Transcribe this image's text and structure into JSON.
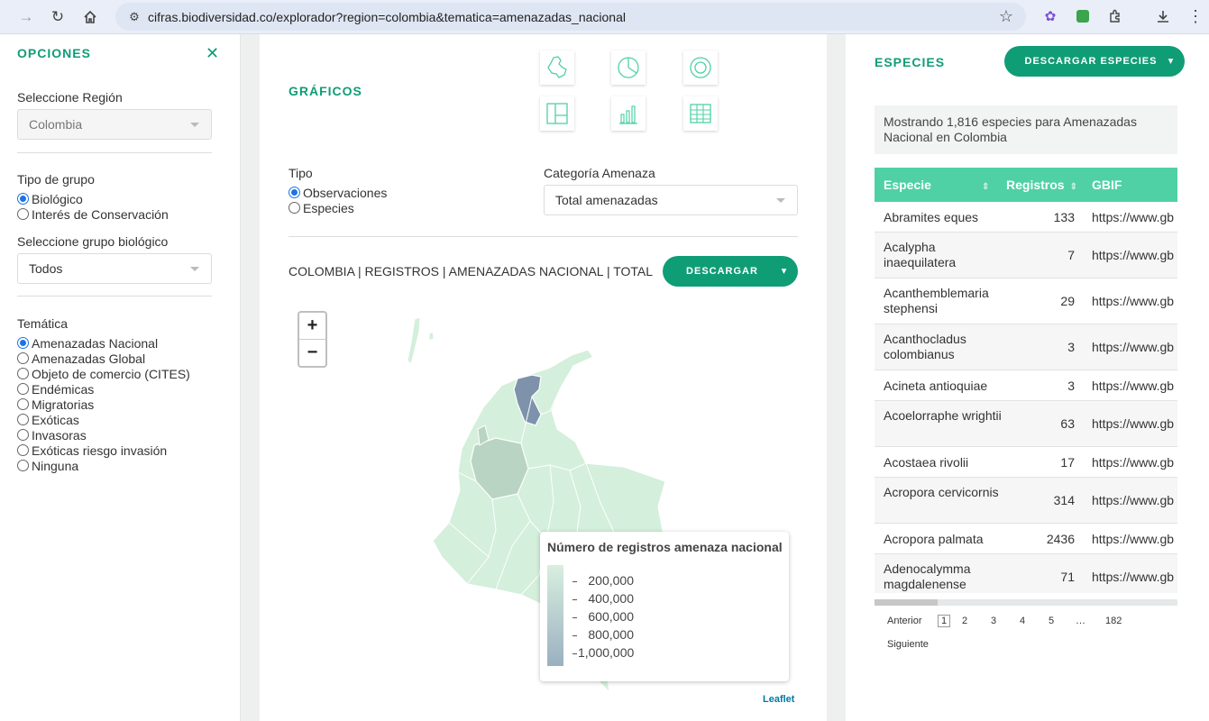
{
  "browser": {
    "url": "cifras.biodiversidad.co/explorador?region=colombia&tematica=amenazadas_nacional"
  },
  "left": {
    "title": "OPCIONES",
    "region_label": "Seleccione Región",
    "region_value": "Colombia",
    "group_type_label": "Tipo de grupo",
    "group_types": [
      "Biológico",
      "Interés de Conservación"
    ],
    "group_type_selected": "Biológico",
    "bio_group_label": "Seleccione grupo biológico",
    "bio_group_value": "Todos",
    "theme_label": "Temática",
    "themes": [
      "Amenazadas Nacional",
      "Amenazadas Global",
      "Objeto de comercio (CITES)",
      "Endémicas",
      "Migratorias",
      "Exóticas",
      "Invasoras",
      "Exóticas riesgo invasión",
      "Ninguna"
    ],
    "theme_selected": "Amenazadas Nacional"
  },
  "center": {
    "charts_title": "GRÁFICOS",
    "chart_icons": [
      "map-icon",
      "pie-chart-icon",
      "donut-chart-icon",
      "treemap-icon",
      "bar-chart-icon",
      "table-icon"
    ],
    "tipo_label": "Tipo",
    "tipo_options": [
      "Observaciones",
      "Especies"
    ],
    "tipo_selected": "Observaciones",
    "category_label": "Categoría Amenaza",
    "category_value": "Total amenazadas",
    "map_title": "COLOMBIA | REGISTROS | AMENAZADAS NACIONAL | TOTAL",
    "download_label": "DESCARGAR",
    "zoom_in": "+",
    "zoom_out": "−",
    "legend_title": "Número de registros amenaza nacional",
    "legend_ticks": [
      "200,000",
      "400,000",
      "600,000",
      "800,000",
      "1,000,000"
    ],
    "attribution": "Leaflet",
    "colors": {
      "low": "#d4efdb",
      "mid": "#b9d4c3",
      "high": "#7e93ab",
      "accent": "#0f9d76"
    }
  },
  "right": {
    "title": "ESPECIES",
    "download_label": "DESCARGAR ESPECIES",
    "info": "Mostrando 1,816 especies para Amenazadas Nacional en Colombia",
    "columns": [
      "Especie",
      "Registros",
      "GBIF"
    ],
    "rows": [
      {
        "name": "Abramites eques",
        "count": "133",
        "gbif": "https://www.gb"
      },
      {
        "name": "Acalypha inaequilatera",
        "count": "7",
        "gbif": "https://www.gb"
      },
      {
        "name": "Acanthemblemaria stephensi",
        "count": "29",
        "gbif": "https://www.gb"
      },
      {
        "name": "Acanthocladus colombianus",
        "count": "3",
        "gbif": "https://www.gb"
      },
      {
        "name": "Acineta antioquiae",
        "count": "3",
        "gbif": "https://www.gb"
      },
      {
        "name": "Acoelorraphe wrightii",
        "count": "63",
        "gbif": "https://www.gb"
      },
      {
        "name": "Acostaea rivolii",
        "count": "17",
        "gbif": "https://www.gb"
      },
      {
        "name": "Acropora cervicornis",
        "count": "314",
        "gbif": "https://www.gb"
      },
      {
        "name": "Acropora palmata",
        "count": "2436",
        "gbif": "https://www.gb"
      },
      {
        "name": "Adenocalymma magdalenense",
        "count": "71",
        "gbif": "https://www.gb"
      }
    ],
    "pager": {
      "prev": "Anterior",
      "pages": [
        "1",
        "2",
        "3",
        "4",
        "5",
        "…",
        "182"
      ],
      "current": "1",
      "next": "Siguiente"
    }
  }
}
